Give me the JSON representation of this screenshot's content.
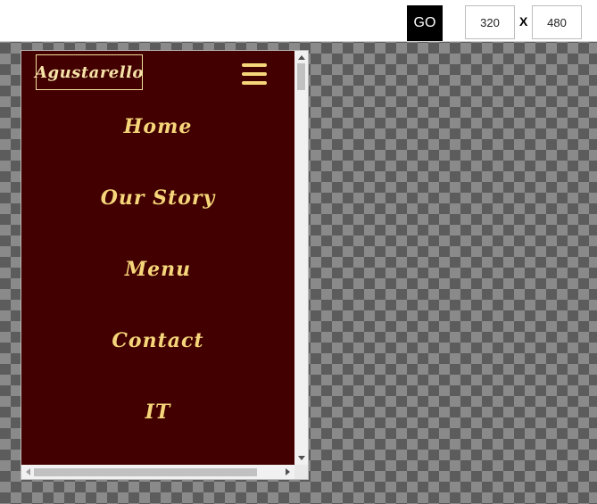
{
  "toolbar": {
    "go_label": "GO",
    "width_value": "320",
    "separator": "X",
    "height_value": "480"
  },
  "site": {
    "brand": "Agustarello",
    "menu_icon": "hamburger-menu-icon",
    "nav_items": [
      {
        "label": "Home"
      },
      {
        "label": "Our Story"
      },
      {
        "label": "Menu"
      },
      {
        "label": "Contact"
      },
      {
        "label": "IT"
      }
    ]
  },
  "colors": {
    "site_background": "#420000",
    "nav_text": "#f6d67a",
    "go_button": "#000000"
  }
}
